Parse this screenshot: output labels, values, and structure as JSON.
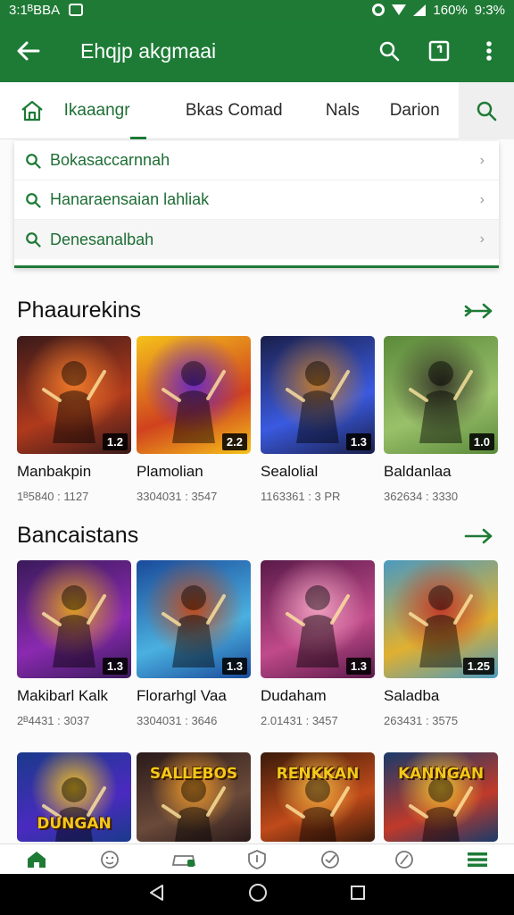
{
  "status_bar": {
    "time": "3:1ᴮBBA",
    "battery": "160%",
    "clock_right": "9:3%"
  },
  "app_bar": {
    "title": "Ehqjp akgmaai"
  },
  "tabs": [
    {
      "label": "Ikaaangr",
      "active": true
    },
    {
      "label": "Bkas Comad",
      "active": false
    },
    {
      "label": "Nals",
      "active": false
    },
    {
      "label": "Darion",
      "active": false
    }
  ],
  "suggestions": [
    {
      "text": "Bokasaccarnnah"
    },
    {
      "text": "Hanaraensaian lahliak"
    },
    {
      "text": "Denesanalbah"
    }
  ],
  "sections": [
    {
      "title": "Phaaurekins",
      "items": [
        {
          "name": "Manbakpin",
          "meta": "1ᴮ5840 : 1127",
          "badge": "1.2",
          "colors": [
            "#3a1a1a",
            "#b03a1c",
            "#f07a2a"
          ]
        },
        {
          "name": "Plamolian",
          "meta": "3304031 : 3547",
          "badge": "2.2",
          "colors": [
            "#f5c21a",
            "#d0421e",
            "#6a2ac2"
          ]
        },
        {
          "name": "Sealolial",
          "meta": "1163361 : 3 PR",
          "badge": "1.3",
          "colors": [
            "#1a1f4a",
            "#3a5ae0",
            "#c07a2a"
          ]
        },
        {
          "name": "Baldanlaa",
          "meta": "362634 : 3330",
          "badge": "1.0",
          "colors": [
            "#5a8a3a",
            "#9ac06a",
            "#3a3a2a"
          ]
        }
      ]
    },
    {
      "title": "Bancaistans",
      "items": [
        {
          "name": "Makibarl Kalk",
          "meta": "2ᴮ4431 : 3037",
          "badge": "1.3",
          "colors": [
            "#3a1a5a",
            "#8a2ab0",
            "#e0a020"
          ]
        },
        {
          "name": "Florarhgl Vaa",
          "meta": "3304031 : 3646",
          "badge": "1.3",
          "colors": [
            "#1a4a9a",
            "#4ab0e0",
            "#c04a1a"
          ]
        },
        {
          "name": "Dudaham",
          "meta": "2.01431 : 3457",
          "badge": "1.3",
          "colors": [
            "#5a1a4a",
            "#c04a8a",
            "#f0a0c0"
          ]
        },
        {
          "name": "Saladba",
          "meta": "263431 : 3575",
          "badge": "1.25",
          "colors": [
            "#4a9ac0",
            "#e0b030",
            "#c03a2a"
          ]
        }
      ]
    },
    {
      "title": "",
      "items": [
        {
          "name": "",
          "meta": "",
          "banner": "DUNGAN",
          "colors": [
            "#1a3a8a",
            "#4a2ac0",
            "#f0c020"
          ]
        },
        {
          "name": "",
          "meta": "",
          "banner": "SALLEBOS",
          "colors": [
            "#2a1a1a",
            "#6a4a3a",
            "#f09a2a"
          ]
        },
        {
          "name": "",
          "meta": "",
          "banner": "RENKKAN",
          "colors": [
            "#3a1a0a",
            "#c04a1a",
            "#f0b040"
          ]
        },
        {
          "name": "",
          "meta": "",
          "banner": "KANNGAN",
          "colors": [
            "#1a3a6a",
            "#c03a2a",
            "#f0c030"
          ]
        }
      ]
    }
  ],
  "bottom_nav": [
    {
      "icon": "home-icon",
      "active": true
    },
    {
      "icon": "face-icon"
    },
    {
      "icon": "gamepad-icon"
    },
    {
      "icon": "shield-icon"
    },
    {
      "icon": "check-circle-icon"
    },
    {
      "icon": "compass-icon"
    },
    {
      "icon": "menu-icon",
      "active": true
    }
  ],
  "colors": {
    "primary": "#1e7b36",
    "accent": "#1e6e35"
  }
}
